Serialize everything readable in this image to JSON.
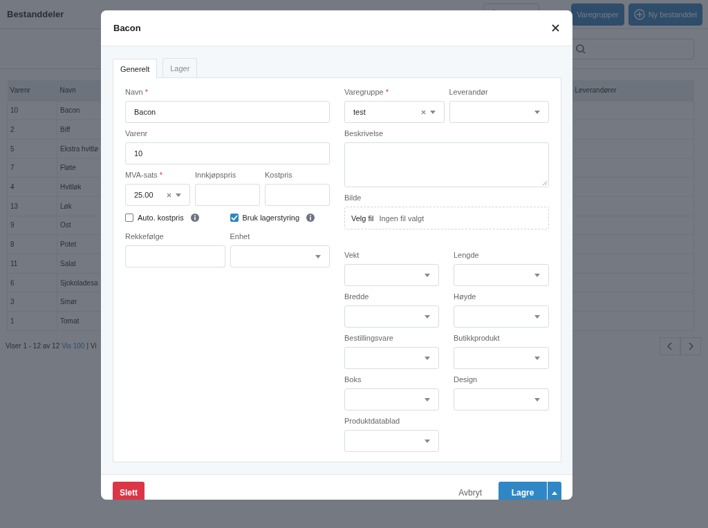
{
  "page": {
    "title": "Bestanddeler",
    "buttons": [
      {
        "kind": "outline"
      },
      {
        "label": "Varegrupper",
        "kind": "primary"
      },
      {
        "label": "Ny bestanddel",
        "kind": "primary-add"
      }
    ]
  },
  "table": {
    "columns": [
      "Varenr",
      "Navn",
      "Leverandører"
    ],
    "rows": [
      [
        "10",
        "Bacon"
      ],
      [
        "2",
        "Biff"
      ],
      [
        "5",
        "Ekstra hvitlø"
      ],
      [
        "7",
        "Fløte"
      ],
      [
        "4",
        "Hvitløk"
      ],
      [
        "13",
        "Løk"
      ],
      [
        "9",
        "Ost"
      ],
      [
        "8",
        "Potet"
      ],
      [
        "11",
        "Salat"
      ],
      [
        "6",
        "Sjokoladesa"
      ],
      [
        "3",
        "Smør"
      ],
      [
        "1",
        "Tomat"
      ]
    ]
  },
  "pager": {
    "summary": "Viser 1 - 12 av 12",
    "link": "Vis 100",
    "rest": "| Vi"
  },
  "modal": {
    "title": "Bacon",
    "tabs": [
      {
        "label": "Generelt",
        "selected": true
      },
      {
        "label": "Lager",
        "selected": false
      }
    ],
    "left_rows": [
      [
        {
          "kind": "text",
          "label": "Navn",
          "required_mark": "*",
          "value": "Bacon"
        }
      ],
      [
        {
          "kind": "text",
          "label": "Varenr",
          "value": "10"
        }
      ],
      [
        {
          "kind": "select",
          "label": "MVA-sats",
          "required_mark": "*",
          "value": "25.00",
          "clearable": true
        },
        {
          "kind": "text",
          "label": "Innkjøpspris"
        },
        {
          "kind": "text",
          "label": "Kostpris"
        }
      ],
      [
        {
          "kind": "checkbox",
          "label": "Auto. kostpris",
          "checked": false,
          "info": true
        },
        {
          "kind": "checkbox",
          "label": "Bruk lagerstyring",
          "checked": true,
          "info": true
        }
      ],
      [
        {
          "kind": "text",
          "label": "Rekkefølge"
        },
        {
          "kind": "select",
          "label": "Enhet"
        }
      ]
    ],
    "right_rows": [
      [
        {
          "kind": "select",
          "label": "Varegruppe",
          "required_mark": "*",
          "value": "test",
          "clearable": true
        },
        {
          "kind": "select",
          "label": "Leverandør"
        }
      ],
      [
        {
          "kind": "textarea",
          "label": "Beskrivelse"
        }
      ],
      [
        {
          "kind": "file",
          "label": "Bilde",
          "button": "Velg fil",
          "status": "Ingen fil valgt"
        }
      ]
    ],
    "detail_rows": [
      [
        {
          "kind": "select",
          "label": "Vekt"
        },
        {
          "kind": "select",
          "label": "Lengde"
        }
      ],
      [
        {
          "kind": "select",
          "label": "Bredde"
        },
        {
          "kind": "select",
          "label": "Høyde"
        }
      ],
      [
        {
          "kind": "select",
          "label": "Bestillingsvare"
        },
        {
          "kind": "select",
          "label": "Butikkprodukt"
        }
      ],
      [
        {
          "kind": "select",
          "label": "Boks"
        },
        {
          "kind": "select",
          "label": "Design"
        }
      ],
      [
        {
          "kind": "select",
          "label": "Produktdatablad"
        }
      ]
    ],
    "footer": {
      "delete": "Slett",
      "cancel": "Avbryt",
      "save": "Lagre"
    }
  }
}
